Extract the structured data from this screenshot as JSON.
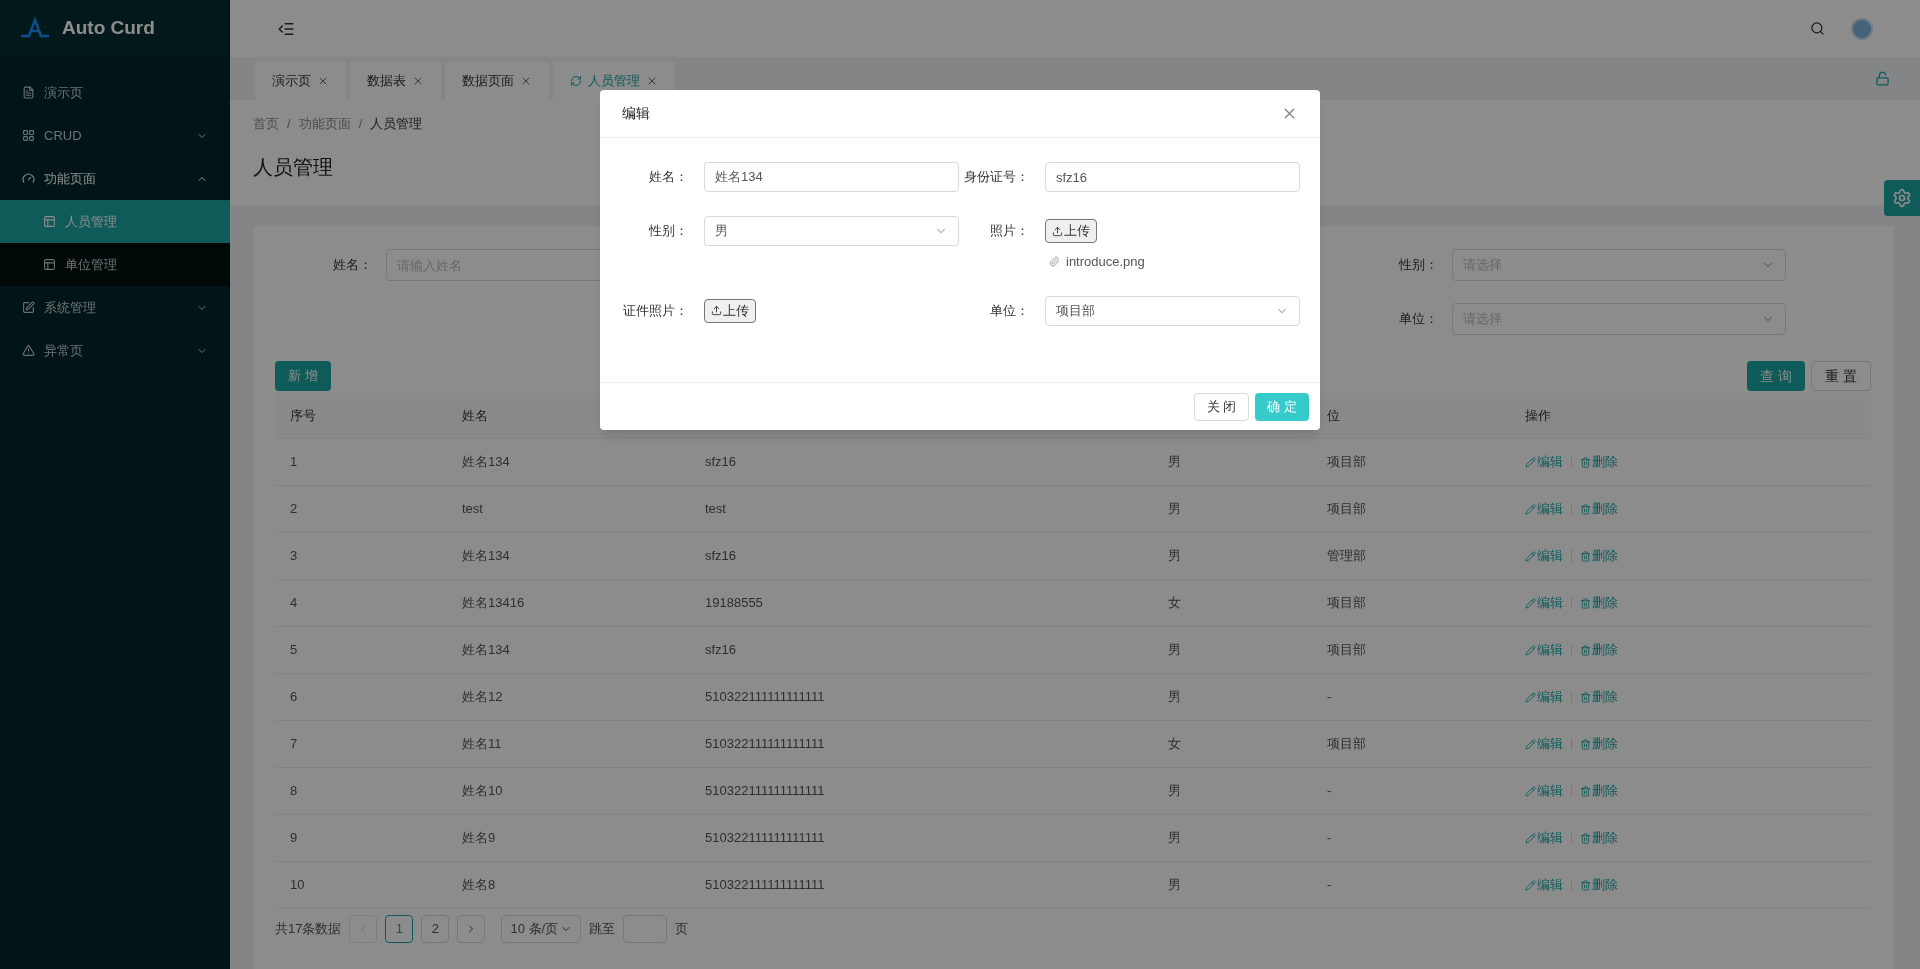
{
  "brand": {
    "name": "Auto Curd"
  },
  "sidebar": {
    "items": [
      {
        "label": "演示页",
        "kind": "file",
        "selected": false
      },
      {
        "label": "CRUD",
        "kind": "grid",
        "selected": false,
        "expanded": false
      },
      {
        "label": "功能页面",
        "kind": "dashboard",
        "selected": true,
        "expanded": true,
        "children": [
          {
            "label": "人员管理",
            "selected": true
          },
          {
            "label": "单位管理",
            "selected": false
          }
        ]
      },
      {
        "label": "系统管理",
        "kind": "edit",
        "selected": false,
        "expanded": false
      },
      {
        "label": "异常页",
        "kind": "warning",
        "selected": false,
        "expanded": false
      }
    ]
  },
  "tabs": [
    {
      "label": "演示页",
      "selected": false
    },
    {
      "label": "数据表",
      "selected": false
    },
    {
      "label": "数据页面",
      "selected": false
    },
    {
      "label": "人员管理",
      "selected": true
    }
  ],
  "breadcrumb": [
    "首页",
    "功能页面",
    "人员管理"
  ],
  "breadcrumb_separator": "/",
  "page_title": "人员管理",
  "filters": [
    {
      "label": "姓名：",
      "kind": "input",
      "placeholder": "请输入姓名"
    },
    {
      "label": "性别：",
      "kind": "select",
      "placeholder": "请选择"
    },
    {
      "label": "单位：",
      "kind": "select",
      "placeholder": "请选择"
    }
  ],
  "add_button": "新 增",
  "search_buttons": [
    {
      "label": "查 询",
      "kind": "primary"
    },
    {
      "label": "重 置",
      "kind": "default"
    }
  ],
  "table": {
    "columns": [
      "序号",
      "姓名",
      null,
      null,
      "位",
      "操作"
    ],
    "rows": [
      {
        "cells": [
          "1",
          "姓名134",
          "sfz16",
          "男",
          "项目部"
        ],
        "actions": [
          "编辑",
          "删除"
        ]
      },
      {
        "cells": [
          "2",
          "test",
          "test",
          "男",
          "项目部"
        ],
        "actions": [
          "编辑",
          "删除"
        ]
      },
      {
        "cells": [
          "3",
          "姓名134",
          "sfz16",
          "男",
          "管理部"
        ],
        "actions": [
          "编辑",
          "删除"
        ]
      },
      {
        "cells": [
          "4",
          "姓名13416",
          "19188555",
          "女",
          "项目部"
        ],
        "actions": [
          "编辑",
          "删除"
        ]
      },
      {
        "cells": [
          "5",
          "姓名134",
          "sfz16",
          "男",
          "项目部"
        ],
        "actions": [
          "编辑",
          "删除"
        ]
      },
      {
        "cells": [
          "6",
          "姓名12",
          "510322111111111111",
          "男",
          "-"
        ],
        "actions": [
          "编辑",
          "删除"
        ]
      },
      {
        "cells": [
          "7",
          "姓名11",
          "510322111111111111",
          "女",
          "项目部"
        ],
        "actions": [
          "编辑",
          "删除"
        ]
      },
      {
        "cells": [
          "8",
          "姓名10",
          "510322111111111111",
          "男",
          "-"
        ],
        "actions": [
          "编辑",
          "删除"
        ]
      },
      {
        "cells": [
          "9",
          "姓名9",
          "510322111111111111",
          "男",
          "-"
        ],
        "actions": [
          "编辑",
          "删除"
        ]
      },
      {
        "cells": [
          "10",
          "姓名8",
          "510322111111111111",
          "男",
          "-"
        ],
        "actions": [
          "编辑",
          "删除"
        ]
      }
    ]
  },
  "pagination": {
    "total": "共17条数据",
    "prev": {
      "disabled": true
    },
    "next": {
      "disabled": false
    },
    "pages": [
      {
        "label": "1",
        "selected": true
      },
      {
        "label": "2",
        "selected": false
      }
    ],
    "page_size": "10 条/页",
    "jump_label": "跳至",
    "page_unit": "页"
  },
  "modal": {
    "title": "编辑",
    "fields": [
      {
        "label": "姓名：",
        "kind": "input",
        "value": "姓名134"
      },
      {
        "label": "身份证号：",
        "kind": "input",
        "value": "sfz16"
      },
      {
        "label": "性别：",
        "kind": "select",
        "value": "男"
      },
      {
        "label": "照片：",
        "kind": "upload",
        "button": "上传",
        "files": [
          "introduce.png"
        ]
      },
      {
        "label": "证件照片：",
        "kind": "upload",
        "button": "上传"
      },
      {
        "label": "单位：",
        "kind": "select",
        "value": "项目部"
      }
    ],
    "buttons": [
      {
        "label": "关 闭",
        "kind": "default"
      },
      {
        "label": "确 定",
        "kind": "primary"
      }
    ]
  }
}
